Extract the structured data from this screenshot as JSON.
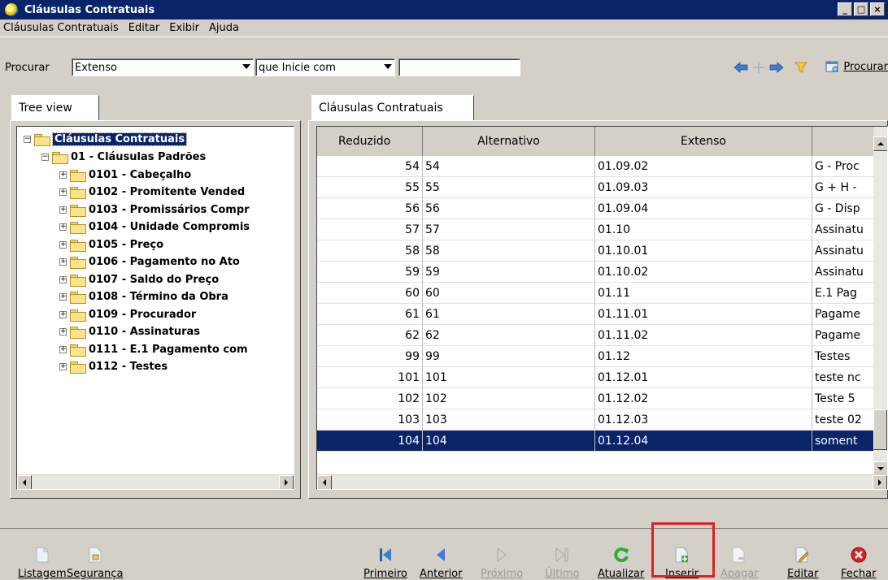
{
  "window": {
    "title": "Cláusulas Contratuais",
    "controls": [
      "_",
      "□",
      "×"
    ]
  },
  "menu": [
    "Cláusulas Contratuais",
    "Editar",
    "Exibir",
    "Ajuda"
  ],
  "search": {
    "label": "Procurar",
    "field_value": "Extenso",
    "mode_value": "que Inicie com",
    "text_value": "",
    "button_label": "Procurar"
  },
  "left_panel": {
    "tab_label": "Tree view",
    "root": "Cláusulas Contratuais",
    "child": "01 - Cláusulas Padrões",
    "items": [
      "0101 - Cabeçalho",
      "0102 - Promitente Vended",
      "0103 - Promissários Compr",
      "0104 - Unidade Compromis",
      "0105 - Preço",
      "0106 - Pagamento no Ato",
      "0107 - Saldo do Preço",
      "0108 - Término da Obra",
      "0109 - Procurador",
      "0110 - Assinaturas",
      "0111 - E.1 Pagamento com",
      "0112 - Testes"
    ]
  },
  "right_panel": {
    "tab_label": "Cláusulas Contratuais",
    "columns": [
      "Reduzido",
      "Alternativo",
      "Extenso",
      ""
    ],
    "rows": [
      [
        "54",
        "54",
        "01.09.02",
        "G - Proc"
      ],
      [
        "55",
        "55",
        "01.09.03",
        "G + H -"
      ],
      [
        "56",
        "56",
        "01.09.04",
        "G - Disp"
      ],
      [
        "57",
        "57",
        "01.10",
        "Assinatu"
      ],
      [
        "58",
        "58",
        "01.10.01",
        "Assinatu"
      ],
      [
        "59",
        "59",
        "01.10.02",
        "Assinatu"
      ],
      [
        "60",
        "60",
        "01.11",
        "E.1 Pag"
      ],
      [
        "61",
        "61",
        "01.11.01",
        "Pagame"
      ],
      [
        "62",
        "62",
        "01.11.02",
        "Pagame"
      ],
      [
        "99",
        "99",
        "01.12",
        "Testes"
      ],
      [
        "101",
        "101",
        "01.12.01",
        "teste nc"
      ],
      [
        "102",
        "102",
        "01.12.02",
        "Teste 5"
      ],
      [
        "103",
        "103",
        "01.12.03",
        "teste 02"
      ],
      [
        "104",
        "104",
        "01.12.04",
        "soment"
      ]
    ]
  },
  "toolbar": {
    "left": [
      "Listagem",
      "Segurança"
    ],
    "nav": [
      "Primeiro",
      "Anterior",
      "Próximo",
      "Último",
      "Atualizar",
      "Inserir",
      "Apagar",
      "Editar",
      "Fechar"
    ]
  },
  "colors": {
    "titlebar": "#0a246a",
    "selection": "#0a246a",
    "highlight": "#e02020"
  }
}
